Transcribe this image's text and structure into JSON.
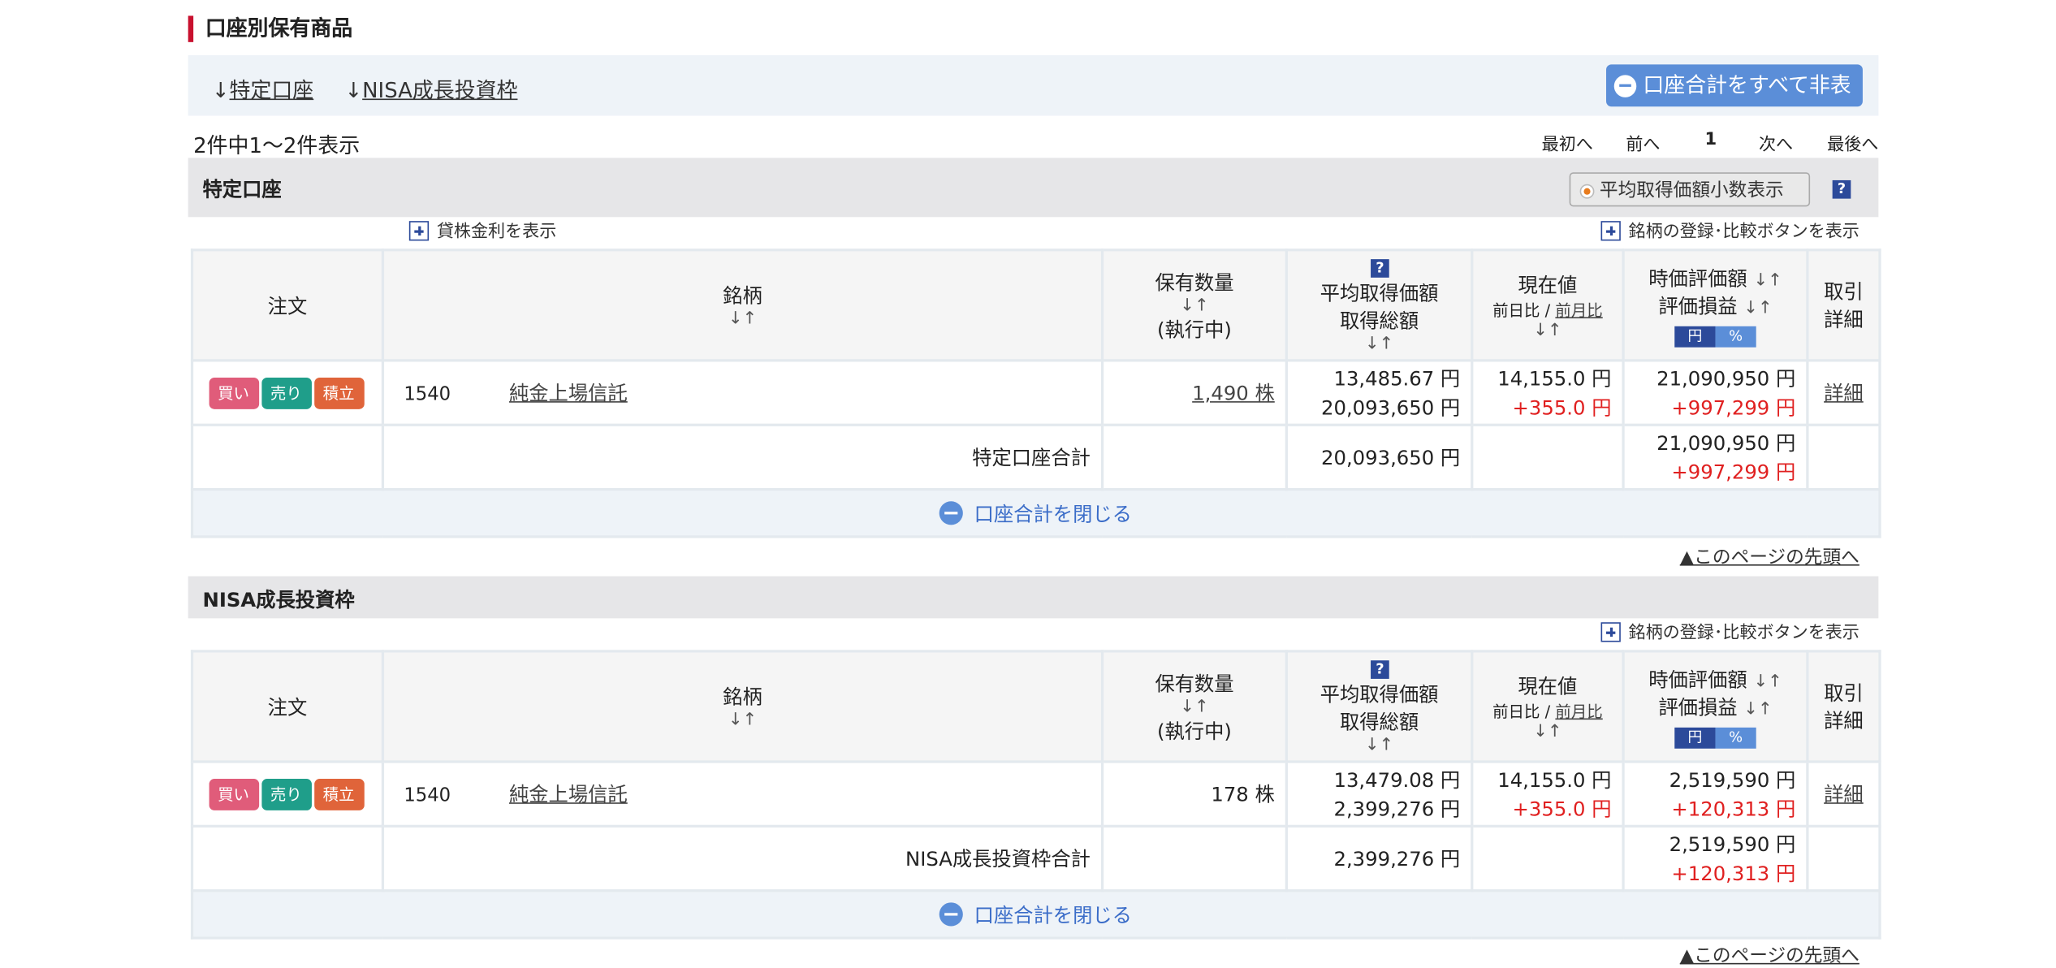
{
  "section_title": "口座別保有商品",
  "nav": {
    "link1": "特定口座",
    "link2": "NISA成長投資枠",
    "arrow": "↓",
    "hide_all_label": "口座合計をすべて非表示"
  },
  "pager": {
    "count_text": "2件中1～2件表示",
    "first": "最初へ",
    "prev": "前へ",
    "current": "1",
    "next": "次へ",
    "last": "最後へ"
  },
  "table_headers": {
    "order": "注文",
    "name": "銘柄",
    "qty": "保有数量",
    "executing": "(執行中)",
    "avg_price": "平均取得価額",
    "total_cost": "取得総額",
    "current_price": "現在値",
    "day_change": "前日比",
    "slash": "/",
    "month_change": "前月比",
    "market_value": "時価評価額",
    "pnl": "評価損益",
    "yen": "円",
    "pct": "%",
    "detail_line1": "取引",
    "detail_line2": "詳細",
    "sort": "↓↑"
  },
  "order_buttons": {
    "buy": "買い",
    "sell": "売り",
    "accum": "積立"
  },
  "detail_link": "詳細",
  "close_label": "口座合計を閉じる",
  "top_link": "▲このページの先頭へ",
  "help": "?",
  "accounts": [
    {
      "title": "特定口座",
      "avg_decimal_label": "平均取得価額小数表示",
      "lending_label": "貸株金利を表示",
      "compare_label": "銘柄の登録･比較ボタンを表示",
      "row": {
        "code": "1540",
        "name": "純金上場信託",
        "qty": "1,490 株",
        "avg_price": "13,485.67 円",
        "total_cost": "20,093,650 円",
        "current_price": "14,155.0 円",
        "day_change": "+355.0 円",
        "market_value": "21,090,950 円",
        "pnl": "+997,299 円"
      },
      "total": {
        "label": "特定口座合計",
        "total_cost": "20,093,650 円",
        "market_value": "21,090,950 円",
        "pnl": "+997,299 円"
      }
    },
    {
      "title": "NISA成長投資枠",
      "compare_label": "銘柄の登録･比較ボタンを表示",
      "row": {
        "code": "1540",
        "name": "純金上場信託",
        "qty": "178 株",
        "avg_price": "13,479.08 円",
        "total_cost": "2,399,276 円",
        "current_price": "14,155.0 円",
        "day_change": "+355.0 円",
        "market_value": "2,519,590 円",
        "pnl": "+120,313 円"
      },
      "total": {
        "label": "NISA成長投資枠合計",
        "total_cost": "2,399,276 円",
        "market_value": "2,519,590 円",
        "pnl": "+120,313 円"
      }
    }
  ]
}
